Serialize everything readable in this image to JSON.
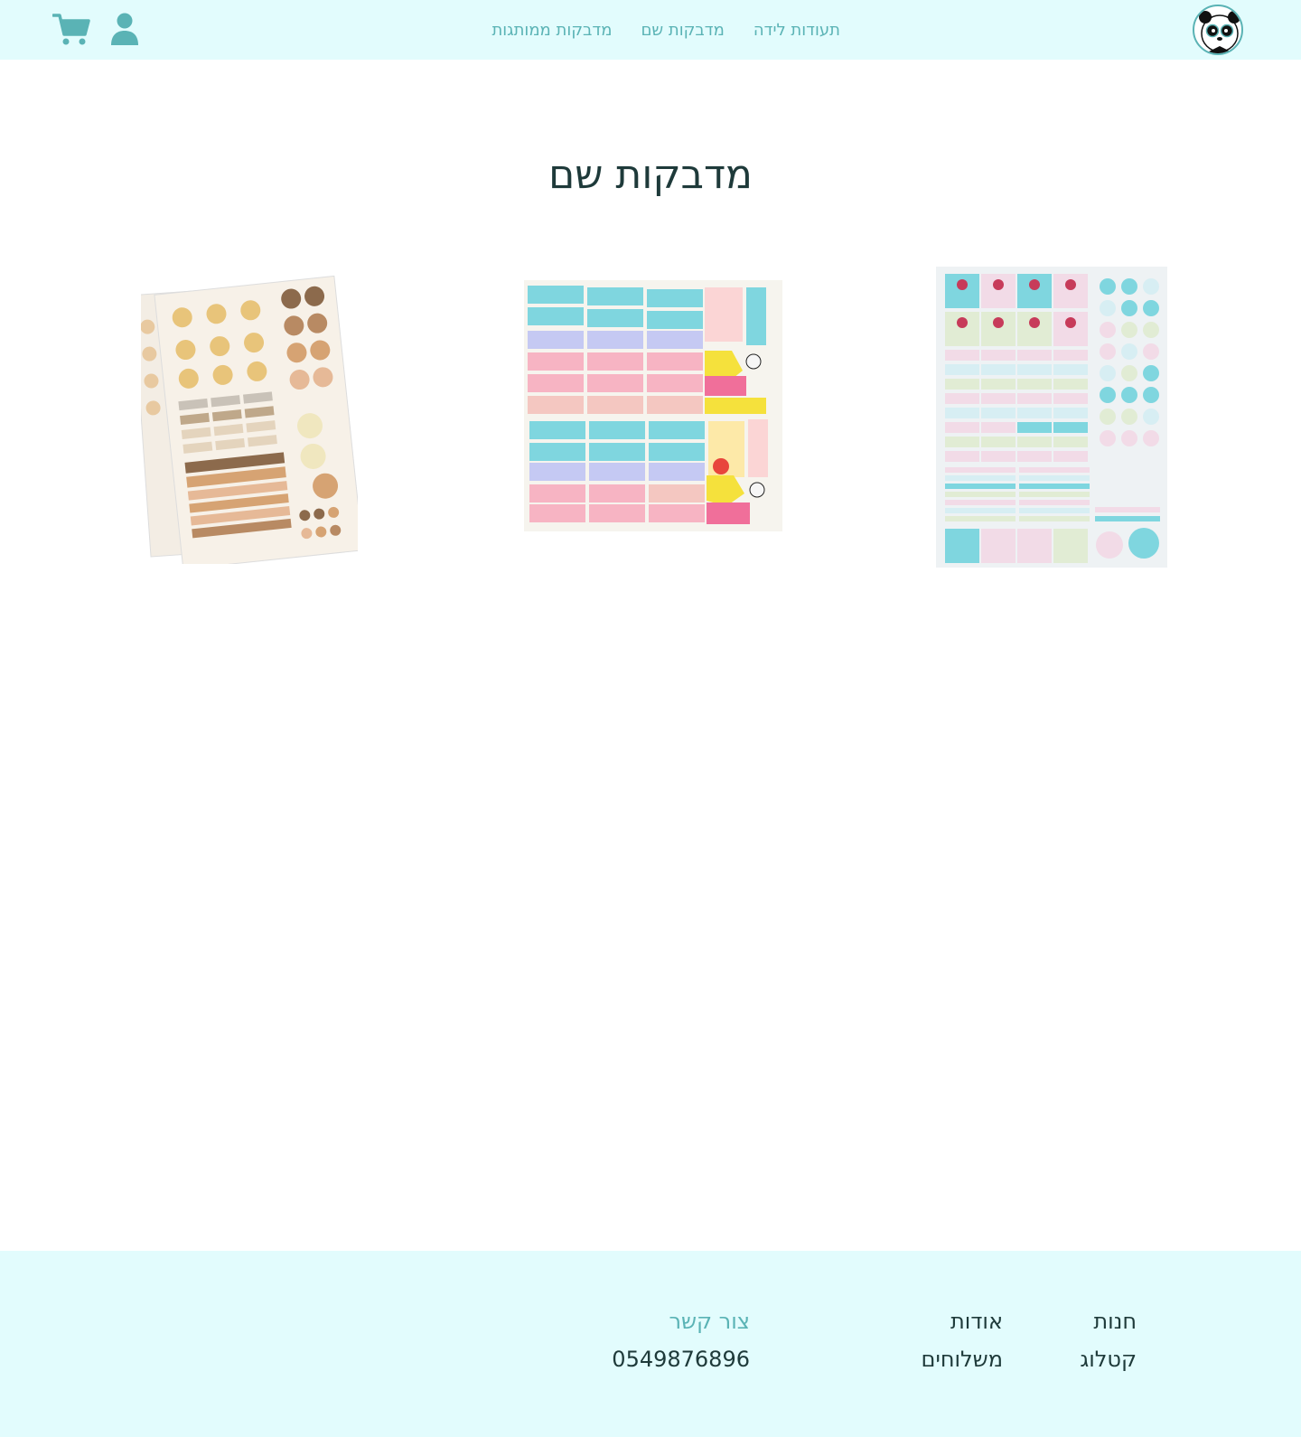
{
  "header": {
    "nav": [
      {
        "label": "תעודות לידה"
      },
      {
        "label": "מדבקות שם"
      },
      {
        "label": "מדבקות ממותגות"
      }
    ],
    "logo_icon": "panda-logo-icon",
    "user_icon": "user-icon",
    "cart_icon": "cart-icon"
  },
  "main": {
    "title": "מדבקות שם",
    "products": [
      {
        "image": "name-sticker-sheet-animals-pastel"
      },
      {
        "image": "name-sticker-sheet-cartoon"
      },
      {
        "image": "name-sticker-sheets-earth-tones"
      }
    ]
  },
  "footer": {
    "col1": [
      "חנות",
      "קטלוג"
    ],
    "col2": [
      "אודות",
      "משלוחים"
    ],
    "contact_heading": "צור קשר",
    "phone": "0549876896"
  },
  "colors": {
    "header_bg": "#e2fcfd",
    "accent": "#5ab3b5",
    "text": "#1e3a3a"
  }
}
